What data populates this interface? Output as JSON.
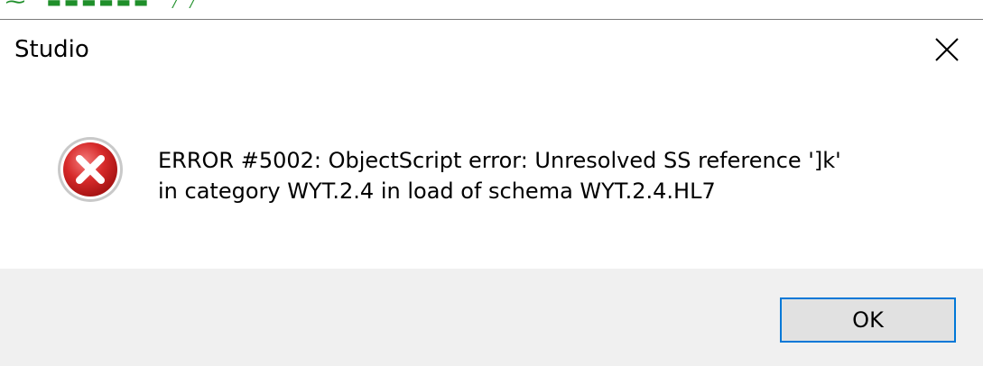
{
  "window": {
    "title": "Studio"
  },
  "message": {
    "line1": "ERROR #5002: ObjectScript error: Unresolved SS reference ']k'",
    "line2": "in category WYT.2.4 in load of schema WYT.2.4.HL7"
  },
  "buttons": {
    "ok_label": "OK"
  },
  "icons": {
    "close": "close-icon",
    "error": "error-icon"
  },
  "colors": {
    "error_red": "#d32f2f",
    "focus_border": "#0078d7",
    "footer_bg": "#f0f0f0"
  }
}
